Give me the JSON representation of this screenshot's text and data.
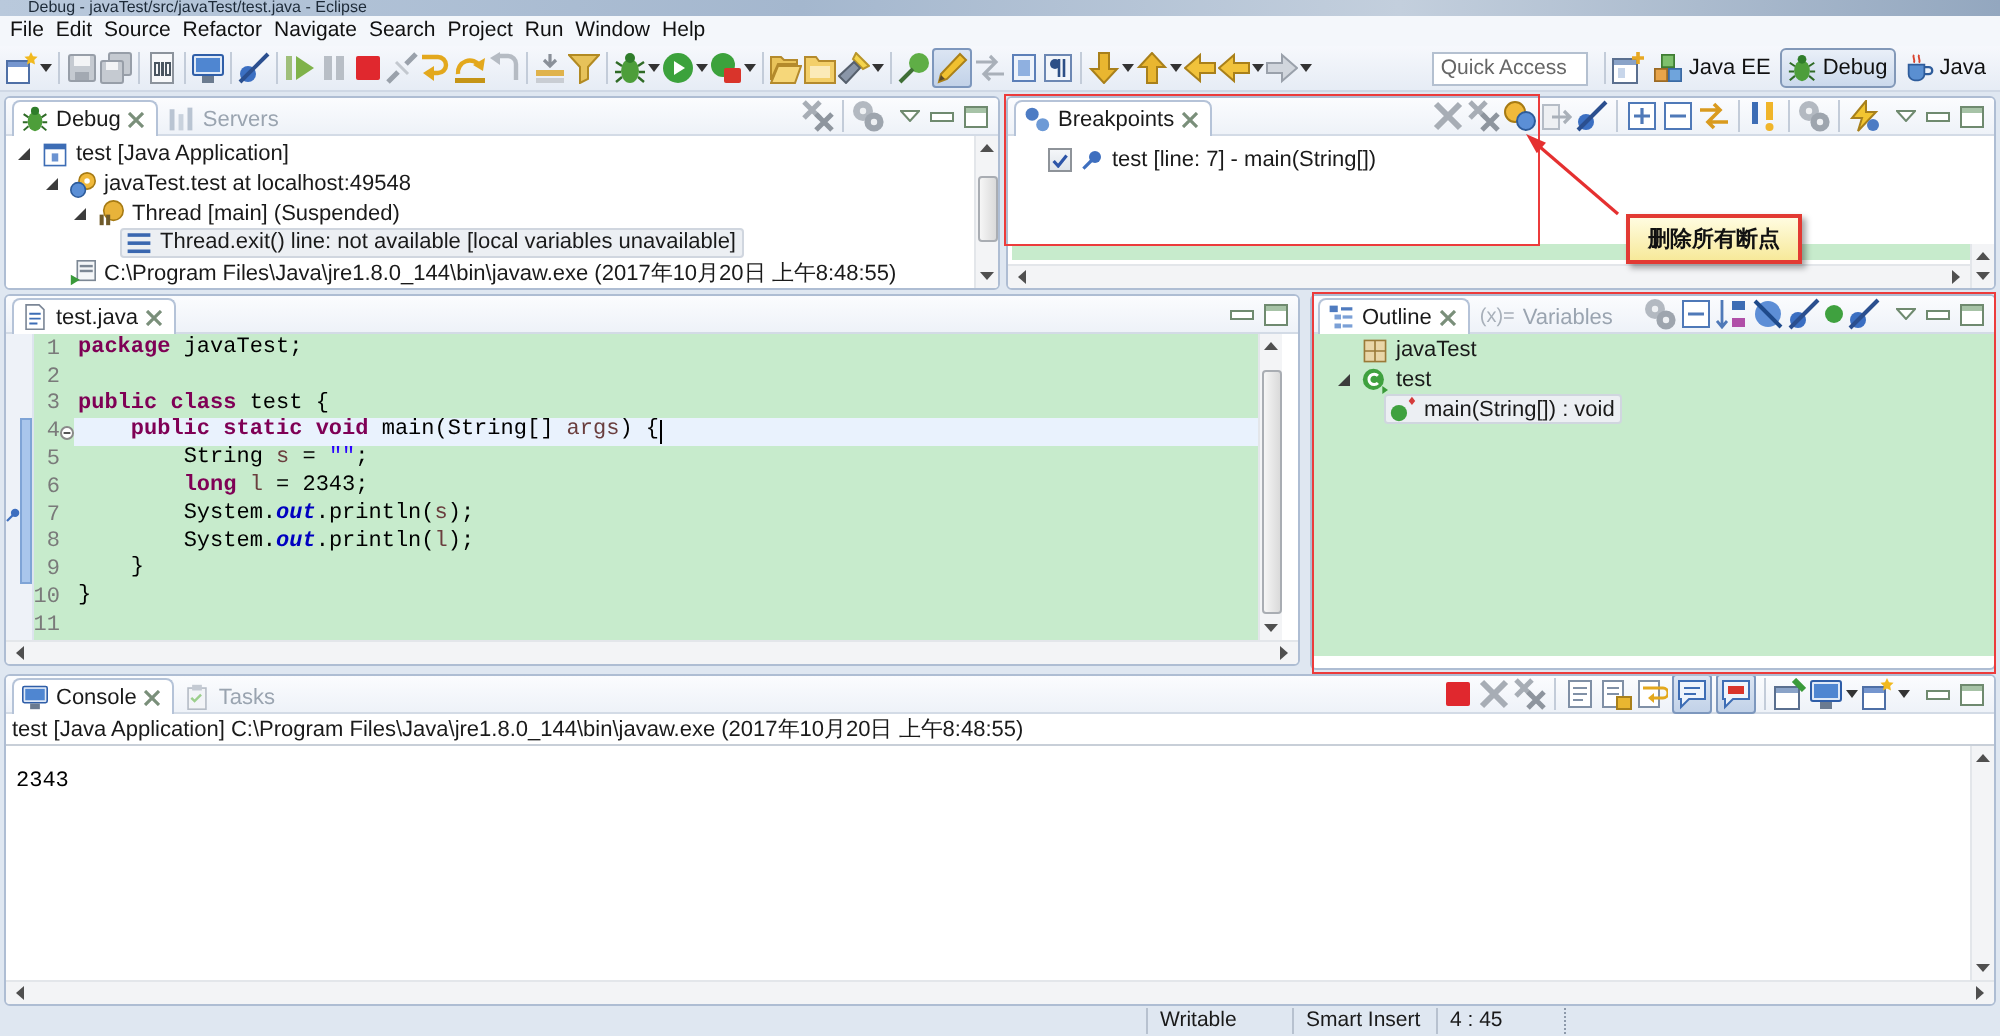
{
  "window": {
    "title": "Debug - javaTest/src/javaTest/test.java - Eclipse"
  },
  "menu": [
    "File",
    "Edit",
    "Source",
    "Refactor",
    "Navigate",
    "Search",
    "Project",
    "Run",
    "Window",
    "Help"
  ],
  "toolbar": {
    "highlight_toggle": {
      "pressed": true
    },
    "quick_access": {
      "placeholder": "Quick Access"
    },
    "perspectives": [
      {
        "label": "Java EE",
        "selected": false
      },
      {
        "label": "Debug",
        "selected": true
      },
      {
        "label": "Java",
        "selected": false
      }
    ]
  },
  "debug_view": {
    "tabs": [
      {
        "label": "Debug",
        "selected": true
      },
      {
        "label": "Servers",
        "selected": false
      }
    ],
    "tree": [
      {
        "kind": "launch",
        "label": "test [Java Application]",
        "selected": false,
        "expanded": true,
        "children": [
          {
            "kind": "target",
            "label": "javaTest.test at localhost:49548",
            "selected": false,
            "expanded": true,
            "children": [
              {
                "kind": "thread",
                "label": "Thread [main] (Suspended)",
                "selected": false,
                "expanded": true,
                "children": [
                  {
                    "kind": "frame",
                    "label": "Thread.exit() line: not available [local variables unavailable]",
                    "selected": true
                  }
                ]
              }
            ]
          },
          {
            "kind": "process",
            "label": "C:\\Program Files\\Java\\jre1.8.0_144\\bin\\javaw.exe (2017年10月20日 上午8:48:55)",
            "selected": false
          }
        ]
      }
    ]
  },
  "breakpoints_view": {
    "tabs": [
      {
        "label": "Breakpoints",
        "selected": true
      }
    ],
    "items": [
      {
        "label": "test [line: 7] - main(String[])",
        "checked": true
      }
    ]
  },
  "editor": {
    "tabs": [
      {
        "label": "test.java",
        "selected": true
      }
    ],
    "lines": [
      {
        "number": "1",
        "tokens": [
          {
            "kind": "keyword",
            "text": "package"
          },
          {
            "kind": "plain",
            "text": " javaTest;"
          }
        ],
        "current": false,
        "foldable": false,
        "in_range": false,
        "breakpoint": false
      },
      {
        "number": "2",
        "current": false,
        "foldable": false,
        "in_range": false,
        "breakpoint": false
      },
      {
        "number": "3",
        "tokens": [
          {
            "kind": "keyword",
            "text": "public"
          },
          {
            "kind": "keyword",
            "text": " class"
          },
          {
            "kind": "plain",
            "text": " test {"
          }
        ],
        "current": false,
        "foldable": false,
        "in_range": false,
        "breakpoint": false
      },
      {
        "number": "4",
        "tokens": [
          {
            "kind": "keyword",
            "text": "    public"
          },
          {
            "kind": "keyword",
            "text": " static"
          },
          {
            "kind": "keyword",
            "text": " void"
          },
          {
            "kind": "plain",
            "text": " main(String[] "
          },
          {
            "kind": "variable",
            "text": "args"
          },
          {
            "kind": "plain",
            "text": ") {"
          }
        ],
        "current": true,
        "foldable": true,
        "in_range": true,
        "breakpoint": false
      },
      {
        "number": "5",
        "tokens": [
          {
            "kind": "plain",
            "text": "        String "
          },
          {
            "kind": "variable",
            "text": "s"
          },
          {
            "kind": "plain",
            "text": " = "
          },
          {
            "kind": "string",
            "text": "\"\""
          },
          {
            "kind": "plain",
            "text": ";"
          }
        ],
        "current": false,
        "foldable": false,
        "in_range": true,
        "breakpoint": false
      },
      {
        "number": "6",
        "tokens": [
          {
            "kind": "keyword",
            "text": "        long"
          },
          {
            "kind": "variable",
            "text": " l"
          },
          {
            "kind": "plain",
            "text": " = 2343;"
          }
        ],
        "current": false,
        "foldable": false,
        "in_range": true,
        "breakpoint": false
      },
      {
        "number": "7",
        "tokens": [
          {
            "kind": "plain",
            "text": "        System."
          },
          {
            "kind": "field",
            "text": "out"
          },
          {
            "kind": "plain",
            "text": ".println("
          },
          {
            "kind": "variable",
            "text": "s"
          },
          {
            "kind": "plain",
            "text": ");"
          }
        ],
        "current": false,
        "foldable": false,
        "in_range": true,
        "breakpoint": true
      },
      {
        "number": "8",
        "tokens": [
          {
            "kind": "plain",
            "text": "        System."
          },
          {
            "kind": "field",
            "text": "out"
          },
          {
            "kind": "plain",
            "text": ".println("
          },
          {
            "kind": "variable",
            "text": "l"
          },
          {
            "kind": "plain",
            "text": ");"
          }
        ],
        "current": false,
        "foldable": false,
        "in_range": true,
        "breakpoint": false
      },
      {
        "number": "9",
        "tokens": [
          {
            "kind": "plain",
            "text": "    }"
          }
        ],
        "current": false,
        "foldable": false,
        "in_range": true,
        "breakpoint": false
      },
      {
        "number": "10",
        "tokens": [
          {
            "kind": "plain",
            "text": "}"
          }
        ],
        "current": false,
        "foldable": false,
        "in_range": false,
        "breakpoint": false
      },
      {
        "number": "11",
        "current": false,
        "foldable": false,
        "in_range": false,
        "breakpoint": false
      }
    ]
  },
  "outline_view": {
    "tabs": [
      {
        "label": "Outline",
        "selected": true
      },
      {
        "label": "Variables",
        "glyph": "(x)=",
        "selected": false
      }
    ],
    "tree": [
      {
        "kind": "package",
        "label": "javaTest",
        "selected": false
      },
      {
        "kind": "class",
        "label": "test",
        "selected": false,
        "expanded": true,
        "children": [
          {
            "kind": "method",
            "label": "main(String[]) : void",
            "selected": true
          }
        ]
      }
    ]
  },
  "console_view": {
    "tabs": [
      {
        "label": "Console",
        "selected": true
      },
      {
        "label": "Tasks",
        "selected": false
      }
    ],
    "toolbar_toggles": [
      {
        "pressed": true
      },
      {
        "pressed": true
      }
    ],
    "process_label": "test [Java Application] C:\\Program Files\\Java\\jre1.8.0_144\\bin\\javaw.exe (2017年10月20日 上午8:48:55)",
    "output": [
      "2343"
    ]
  },
  "status_bar": {
    "fields": [
      "Writable",
      "Smart Insert",
      "4 : 45"
    ]
  },
  "callout": {
    "text": "删除所有断点"
  }
}
